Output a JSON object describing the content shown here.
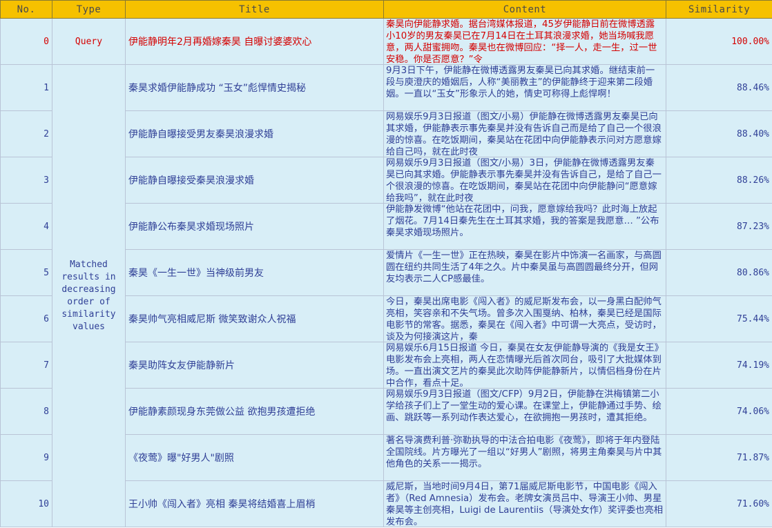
{
  "headers": [
    "No.",
    "Type",
    "Title",
    "Content",
    "Similarity"
  ],
  "query": {
    "no": "0",
    "type": "Query",
    "title": "伊能静明年2月再婚嫁秦昊 自曝讨婆婆欢心",
    "content": "秦昊向伊能静求婚。据台湾媒体报道，45岁伊能静日前在微博透露小10岁的男友秦昊已在7月14日在土耳其浪漫求婚，她当场喊我愿意，两人甜蜜拥吻。秦昊也在微博回应：“择一人，走一生，过一世安稳。你是否愿意？”令",
    "similarity": "100.00%"
  },
  "matched_label": "Matched results in decreasing order of similarity values",
  "rows": [
    {
      "no": "1",
      "title": "秦昊求婚伊能静成功 “玉女”彪悍情史揭秘",
      "content": "9月3日下午，伊能静在微博透露男友秦昊已向其求婚。继结束前一段与庾澄庆的婚姻后，人称“美丽教主”的伊能静终于迎来第二段婚姻。一直以“玉女”形象示人的她，情史可称得上彪悍啊！",
      "similarity": "88.46%"
    },
    {
      "no": "2",
      "title": "伊能静自曝接受男友秦昊浪漫求婚",
      "content": "网易娱乐9月3日报道（图文/小易）伊能静在微博透露男友秦昊已向其求婚，伊能静表示事先秦昊并没有告诉自己而是给了自己一个很浪漫的惊喜。在吃饭期间，秦昊站在花团中向伊能静表示问对方愿意嫁给自己吗，就在此时夜",
      "similarity": "88.40%"
    },
    {
      "no": "3",
      "title": "伊能静自曝接受秦昊浪漫求婚",
      "content": "网易娱乐9月3日报道（图文/小易）3日，伊能静在微博透露男友秦昊已向其求婚。伊能静表示事先秦昊并没有告诉自己，是给了自己一个很浪漫的惊喜。在吃饭期间，秦昊站在花团中向伊能静问“愿意嫁给我吗”，就在此时夜",
      "similarity": "88.26%"
    },
    {
      "no": "4",
      "title": "伊能静公布秦昊求婚现场照片",
      "content": "伊能静发微博“他站在花团中，问我，愿意嫁给我吗？此时海上放起了烟花。7月14日秦先生在土耳其求婚，我的答案是我愿意… ”公布秦昊求婚现场照片。",
      "similarity": "87.23%"
    },
    {
      "no": "5",
      "title": "秦昊《一生一世》当神级前男友",
      "content": "爱情片《一生一世》正在热映，秦昊在影片中饰演一名画家，与高圆圆在纽约共同生活了4年之久。片中秦昊虽与高圆圆最终分开，但网友均表示二人CP感最佳。",
      "similarity": "80.86%"
    },
    {
      "no": "6",
      "title": "秦昊帅气亮相威尼斯 微笑致谢众人祝福",
      "content": "今日，秦昊出席电影《闯入者》的威尼斯发布会，以一身黑白配帅气亮相，笑容亲和不失气场。曾多次入围戛纳、柏林，秦昊已经是国际电影节的常客。据悉，秦昊在《闯入者》中可谓一大亮点，受访时，谈及为何接演这片，秦",
      "similarity": "75.44%"
    },
    {
      "no": "7",
      "title": "秦昊助阵女友伊能静新片",
      "content": "网易娱乐6月15日报道 今日，秦昊在女友伊能静导演的《我是女王》电影发布会上亮相，两人在恋情曝光后首次同台，吸引了大批媒体到场。一直出演文艺片的秦昊此次助阵伊能静新片，以情侣档身份在片中合作，看点十足。",
      "similarity": "74.19%"
    },
    {
      "no": "8",
      "title": "伊能静素颜现身东莞做公益 欲抱男孩遭拒绝",
      "content": "网易娱乐9月3日报道（图文/CFP）9月2日，伊能静在洪梅镇第二小学给孩子们上了一堂生动的爱心课。在课堂上，伊能静通过手势、绘画、跳跃等一系列动作表达爱心，在欲拥抱一男孩时，遭其拒绝。",
      "similarity": "74.06%"
    },
    {
      "no": "9",
      "title": "《夜莺》曝\"好男人\"剧照",
      "content": "著名导演费利普·弥勒执导的中法合拍电影《夜莺》，即将于年内登陆全国院线。片方曝光了一组以“好男人”剧照，将男主角秦昊与片中其他角色的关系一一揭示。",
      "similarity": "71.87%"
    },
    {
      "no": "10",
      "title": "王小帅《闯入者》亮相 秦昊将结婚喜上眉梢",
      "content": "威尼斯，当地时间9月4日，第71届威尼斯电影节，中国电影《闯入者》（Red Amnesia）发布会。老牌女演员吕中、导演王小帅、男星秦昊等主创亮相，Luigi de Laurentiis（导演处女作）奖评委也亮相发布会。",
      "similarity": "71.60%"
    }
  ]
}
